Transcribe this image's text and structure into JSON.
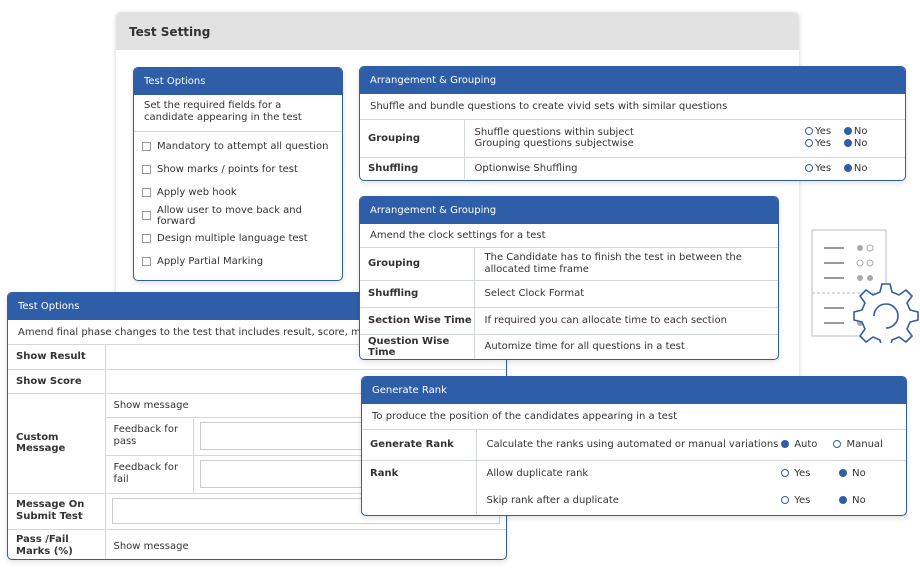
{
  "main": {
    "title": "Test Setting"
  },
  "test_options_top": {
    "title": "Test Options",
    "description": "Set the required fields for a candidate appearing in the test",
    "options": [
      "Mandatory to attempt all question",
      "Show marks / points for test",
      "Apply web hook",
      "Allow user to move back and forward",
      "Design multiple language test",
      "Apply Partial Marking"
    ]
  },
  "arrangement1": {
    "title": "Arrangement & Grouping",
    "description": "Shuffle and bundle questions to create vivid sets with similar questions",
    "rows": [
      {
        "label": "Grouping",
        "lines": [
          "Shuffle questions within subject",
          "Grouping questions subjectwise"
        ],
        "yes": "Yes",
        "no": "No"
      },
      {
        "label": "Shuffling",
        "lines": [
          "Optionwise Shuffling"
        ],
        "yes": "Yes",
        "no": "No"
      }
    ]
  },
  "arrangement2": {
    "title": "Arrangement & Grouping",
    "description": "Amend the clock settings for a test",
    "rows": [
      {
        "label": "Grouping",
        "text": "The Candidate has to finish the test in between the allocated time frame"
      },
      {
        "label": "Shuffling",
        "text": "Select Clock Format"
      },
      {
        "label": "Section Wise Time",
        "text": "If required you can allocate time to each section"
      },
      {
        "label": "Question Wise Time",
        "text": "Automize time for all questions in a test"
      }
    ]
  },
  "test_options_bottom": {
    "title": "Test Options",
    "description": "Amend final phase changes to the test that includes result, score, message",
    "show_result": "Show Result",
    "show_score": "Show Score",
    "custom_message": "Custom Message",
    "show_message": "Show message",
    "feedback_pass": "Feedback for pass",
    "feedback_fail": "Feedback for fail",
    "message_on_submit": "Message On Submit Test",
    "pass_fail": "Pass /Fail Marks (%)",
    "pass_fail_value": "Show message"
  },
  "generate_rank": {
    "title": "Generate Rank",
    "description": "To produce the position of the candidates appearing in a test",
    "gen_label": "Generate Rank",
    "gen_text": "Calculate the ranks using automated or manual variations",
    "auto": "Auto",
    "manual": "Manual",
    "rank_label": "Rank",
    "allow_dup": "Allow duplicate rank",
    "skip_rank": "Skip rank after a duplicate",
    "yes": "Yes",
    "no": "No"
  },
  "colors": {
    "accent": "#2f5ea8",
    "header_gray": "#e2e2e2",
    "border": "#d3d8de"
  },
  "icons": [
    "checklist-document-icon",
    "gear-icon"
  ]
}
